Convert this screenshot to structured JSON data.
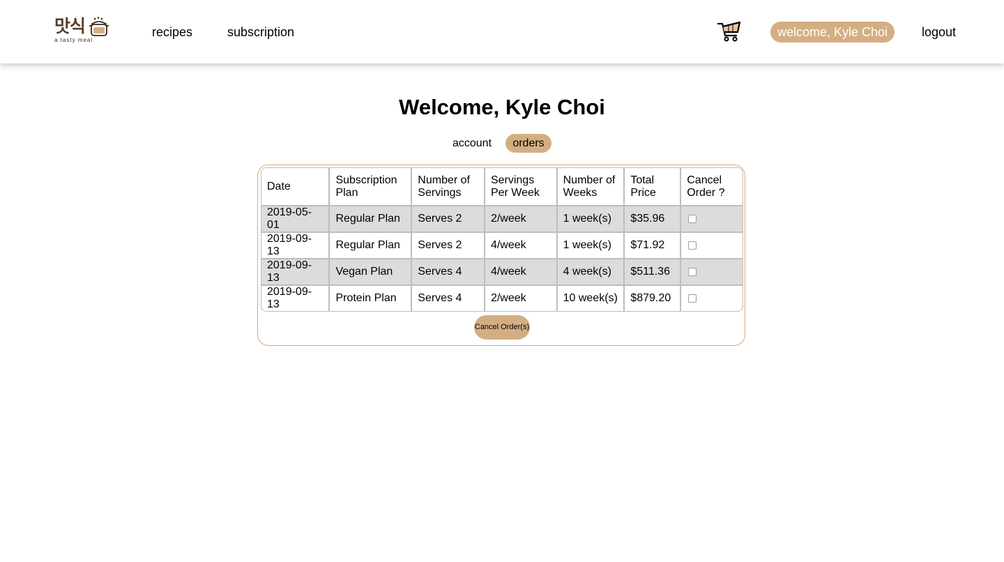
{
  "brand": {
    "logo_text": "맛식",
    "tagline": "a tasty meal"
  },
  "nav": {
    "recipes": "recipes",
    "subscription": "subscription",
    "welcome": "welcome, Kyle Choi",
    "logout": "logout"
  },
  "main": {
    "title": "Welcome, Kyle Choi",
    "tabs": [
      {
        "label": "account",
        "active": false
      },
      {
        "label": "orders",
        "active": true
      }
    ]
  },
  "orders": {
    "columns": [
      "Date",
      "Subscription Plan",
      "Number of Servings",
      "Servings Per Week",
      "Number of Weeks",
      "Total Price",
      "Cancel Order ?"
    ],
    "rows": [
      {
        "date": "2019-05-01",
        "plan": "Regular Plan",
        "servings": "Serves 2",
        "per_week": "2/week",
        "weeks": "1 week(s)",
        "price": "$35.96",
        "cancel": false
      },
      {
        "date": "2019-09-13",
        "plan": "Regular Plan",
        "servings": "Serves 2",
        "per_week": "4/week",
        "weeks": "1 week(s)",
        "price": "$71.92",
        "cancel": false
      },
      {
        "date": "2019-09-13",
        "plan": "Vegan Plan",
        "servings": "Serves 4",
        "per_week": "4/week",
        "weeks": "4 week(s)",
        "price": "$511.36",
        "cancel": false
      },
      {
        "date": "2019-09-13",
        "plan": "Protein Plan",
        "servings": "Serves 4",
        "per_week": "2/week",
        "weeks": "10 week(s)",
        "price": "$879.20",
        "cancel": false
      }
    ],
    "cancel_button": "Cancel Order(s)"
  },
  "icons": {
    "cart": "shopping-cart-icon",
    "logo_pot": "pot-icon"
  },
  "colors": {
    "accent": "#d4ae83",
    "card_border": "#d9a77a",
    "row_shade": "#dcdcdc",
    "brand_brown": "#5a3e2b"
  }
}
